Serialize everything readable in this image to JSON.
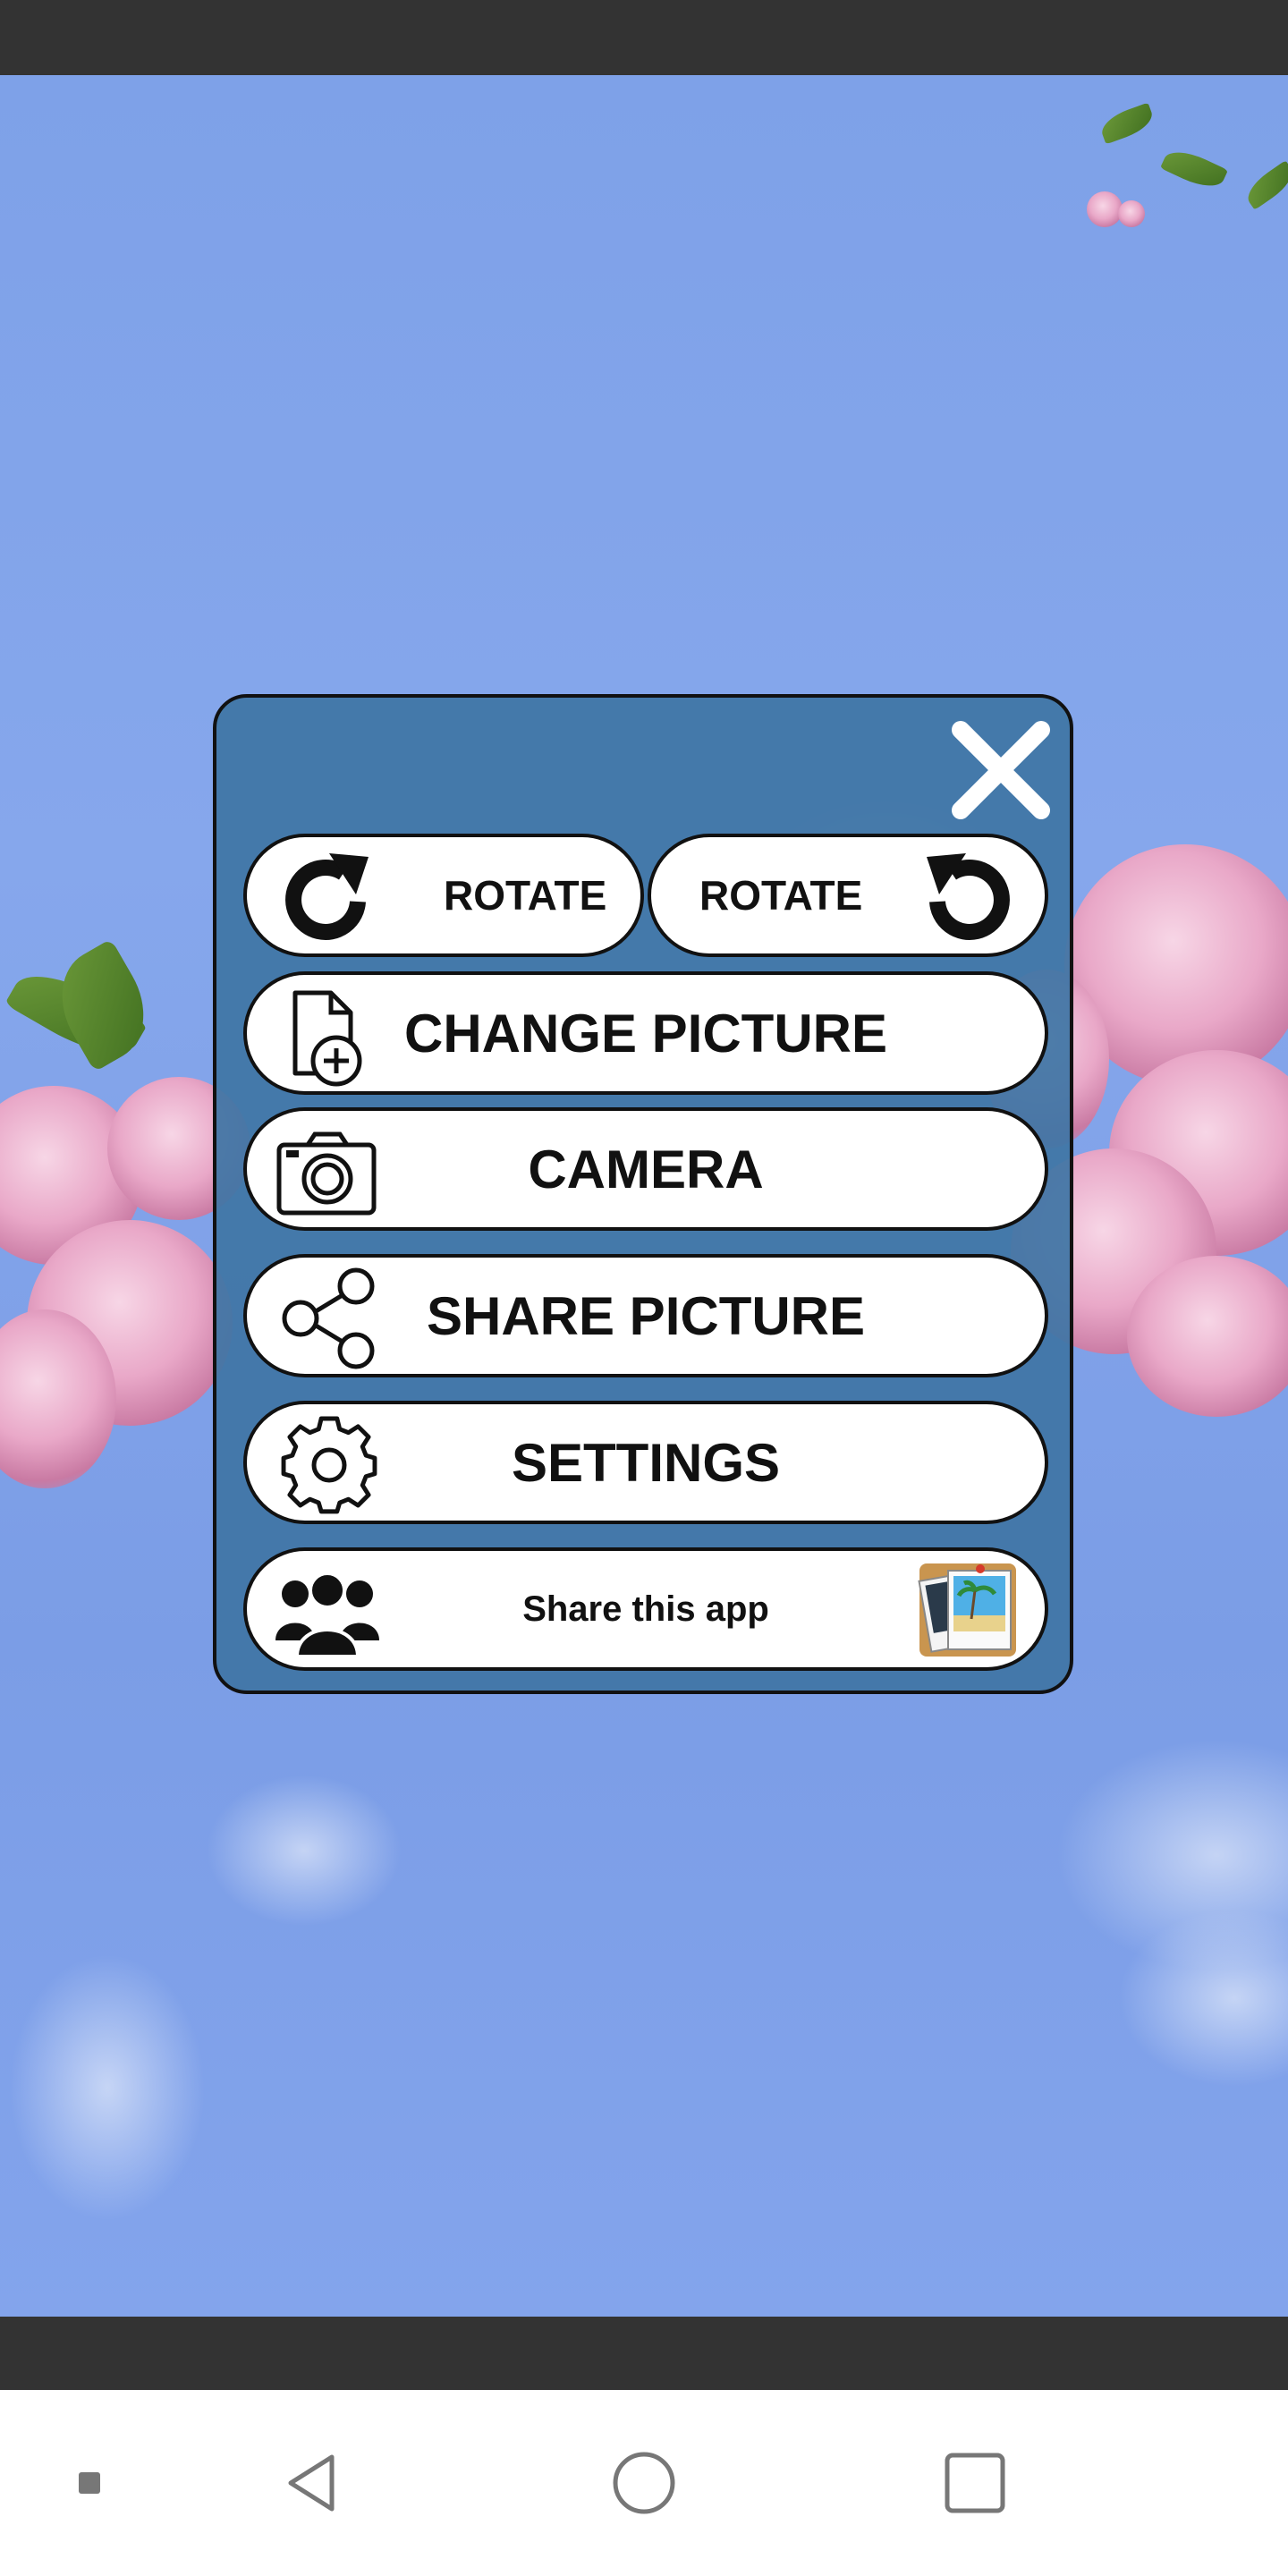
{
  "dialog": {
    "rotate_right_label": "ROTATE",
    "rotate_left_label": "ROTATE",
    "change_picture_label": "CHANGE PICTURE",
    "camera_label": "CAMERA",
    "share_picture_label": "SHARE PICTURE",
    "settings_label": "SETTINGS",
    "share_app_label": "Share this app"
  },
  "icons": {
    "close": "close-icon",
    "rotate_right": "rotate-clockwise-icon",
    "rotate_left": "rotate-counterclockwise-icon",
    "change_picture": "file-add-icon",
    "camera": "camera-icon",
    "share_picture": "share-icon",
    "settings": "gear-icon",
    "share_app": "users-icon",
    "app_logo": "photo-stack-icon"
  },
  "colors": {
    "dialog_bg": "#3f75a5",
    "button_bg": "#ffffff",
    "border": "#111111",
    "sky": "#7ea1e8"
  },
  "nav": {
    "back": "back-icon",
    "home": "home-icon",
    "recents": "recents-icon",
    "menu": "menu-dot-icon"
  }
}
